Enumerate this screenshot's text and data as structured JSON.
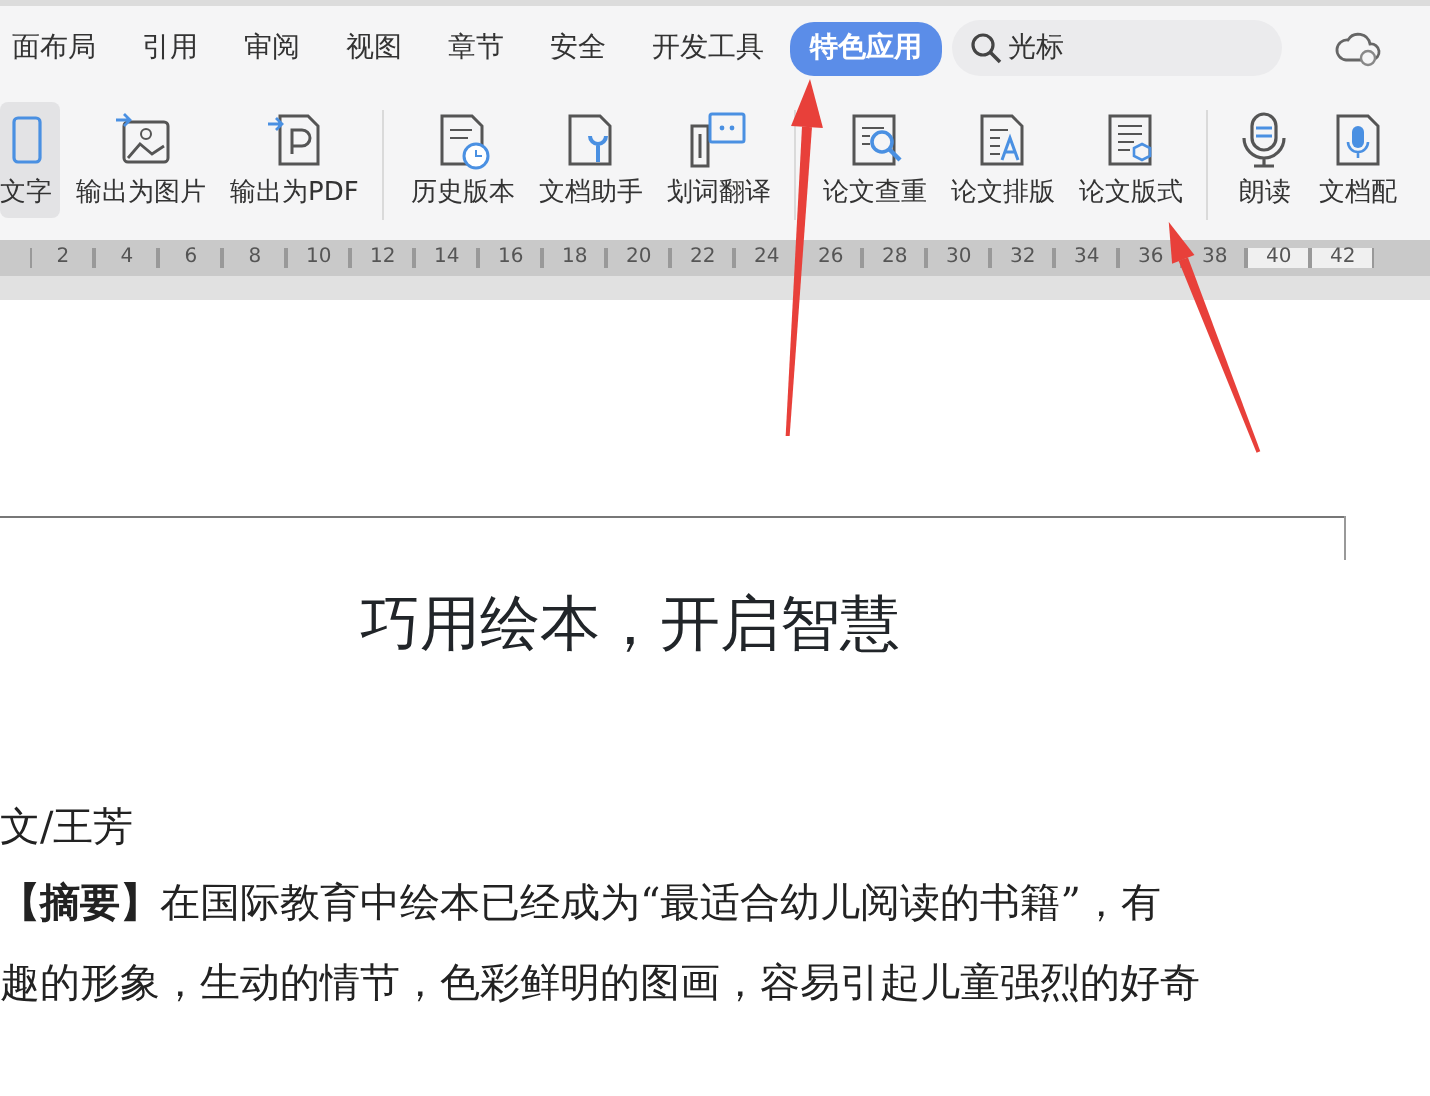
{
  "menu_tabs": [
    {
      "label": "面布局",
      "selected": false
    },
    {
      "label": "引用",
      "selected": false
    },
    {
      "label": "审阅",
      "selected": false
    },
    {
      "label": "视图",
      "selected": false
    },
    {
      "label": "章节",
      "selected": false
    },
    {
      "label": "安全",
      "selected": false
    },
    {
      "label": "开发工具",
      "selected": false
    },
    {
      "label": "特色应用",
      "selected": true
    }
  ],
  "search": {
    "value": "光标"
  },
  "toolbar": [
    {
      "kind": "button",
      "label": "文字",
      "selected": true
    },
    {
      "kind": "button",
      "label": "输出为图片",
      "selected": false
    },
    {
      "kind": "button",
      "label": "输出为PDF",
      "selected": false
    },
    {
      "kind": "separator"
    },
    {
      "kind": "button",
      "label": "历史版本",
      "selected": false
    },
    {
      "kind": "button",
      "label": "文档助手",
      "selected": false
    },
    {
      "kind": "button",
      "label": "划词翻译",
      "selected": false
    },
    {
      "kind": "separator"
    },
    {
      "kind": "button",
      "label": "论文查重",
      "selected": false
    },
    {
      "kind": "button",
      "label": "论文排版",
      "selected": false
    },
    {
      "kind": "button",
      "label": "论文版式",
      "selected": false
    },
    {
      "kind": "separator"
    },
    {
      "kind": "button",
      "label": "朗读",
      "selected": false
    },
    {
      "kind": "button",
      "label": "文档配",
      "selected": false
    }
  ],
  "ruler": [
    "2",
    "4",
    "6",
    "8",
    "10",
    "12",
    "14",
    "16",
    "18",
    "20",
    "22",
    "24",
    "26",
    "28",
    "30",
    "32",
    "34",
    "36",
    "38",
    "40",
    "42"
  ],
  "document": {
    "title": "巧用绘本，开启智慧",
    "author": "文/王芳",
    "paragraphs": [
      "**【摘要】**在国际教育中绘本已经成为“最适合幼儿阅读的书籍”，有",
      "趣的形象，生动的情节，色彩鲜明的图画，容易引起儿童强烈的好奇"
    ]
  },
  "annotation_arrows": [
    {
      "kind": "arrow"
    },
    {
      "kind": "arrow"
    }
  ]
}
